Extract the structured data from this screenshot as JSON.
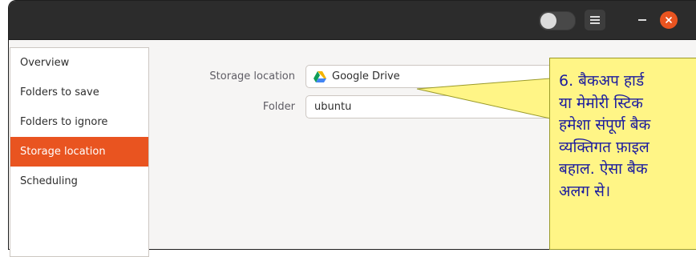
{
  "sidebar": {
    "items": [
      {
        "label": "Overview"
      },
      {
        "label": "Folders to save"
      },
      {
        "label": "Folders to ignore"
      },
      {
        "label": "Storage location"
      },
      {
        "label": "Scheduling"
      }
    ],
    "active_index": 3
  },
  "form": {
    "storage_location_label": "Storage location",
    "storage_location_value": "Google Drive",
    "storage_location_icon": "google-drive-icon",
    "folder_label": "Folder",
    "folder_value": "ubuntu"
  },
  "titlebar": {
    "toggle_icon": "toggle-switch-icon",
    "menu_icon": "hamburger-menu-icon",
    "minimize_icon": "minimize-icon",
    "close_icon": "close-icon"
  },
  "callout": {
    "lines": [
      "6. बैकअप हार्ड",
      "या मेमोरी स्टिक",
      "हमेशा संपूर्ण बैक",
      "व्यक्तिगत फ़ाइल",
      "बहाल. ऐसा बैक",
      "अलग से।"
    ]
  },
  "colors": {
    "accent": "#e95420",
    "callout_bg": "#fff586",
    "callout_text": "#1a1a9e",
    "titlebar": "#2c2c2c"
  }
}
